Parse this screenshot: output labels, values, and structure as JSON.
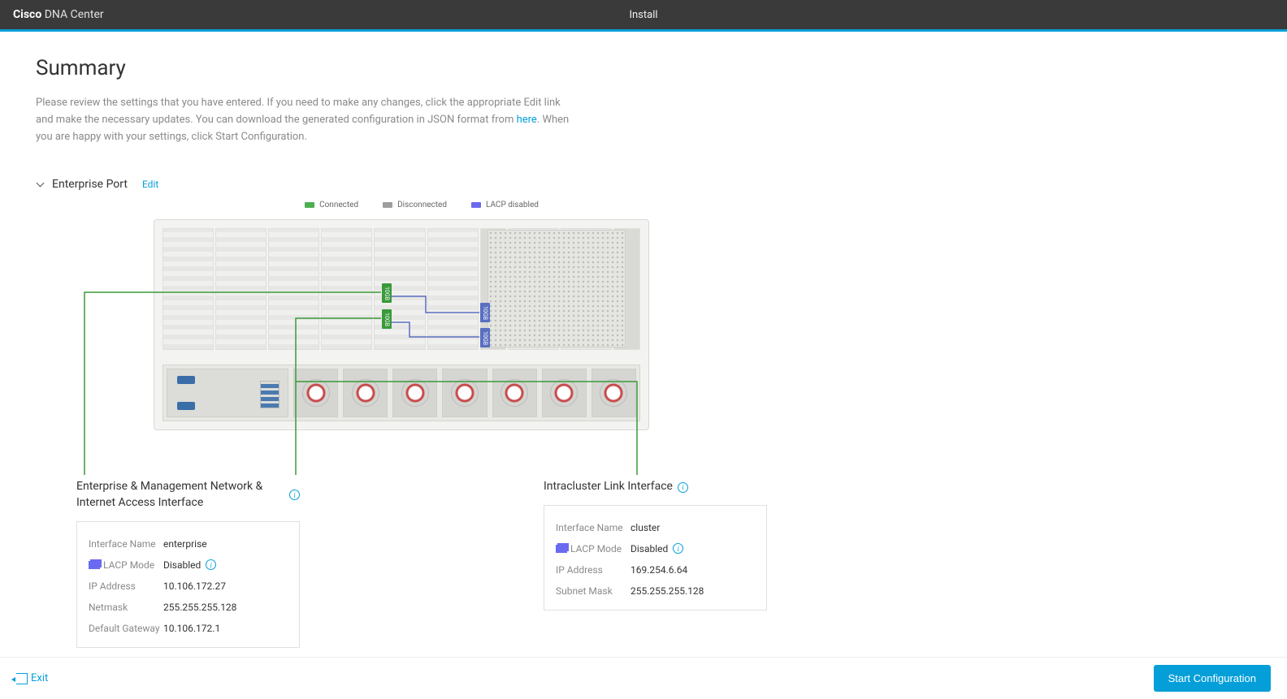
{
  "brand": {
    "bold": "Cisco",
    "light": " DNA Center"
  },
  "header": {
    "title": "Install"
  },
  "page": {
    "title": "Summary",
    "desc_pre": "Please review the settings that you have entered. If you need to make any changes, click the appropriate Edit link and make the necessary updates. You can download the generated configuration in JSON format from ",
    "here": "here",
    "desc_post": ". When you are happy with your settings, click Start Configuration."
  },
  "section": {
    "title": "Enterprise Port",
    "edit": "Edit"
  },
  "legend": {
    "connected": "Connected",
    "disconnected": "Disconnected",
    "lacp": "LACP disabled"
  },
  "ports": {
    "p1": "10GB",
    "p2": "10GB",
    "p3": "10GB",
    "p4": "10GB"
  },
  "callouts": {
    "enterprise": {
      "title": "Enterprise & Management Network & Internet Access Interface",
      "rows": {
        "iface_label": "Interface Name",
        "iface_value": "enterprise",
        "lacp_label": "LACP Mode",
        "lacp_value": "Disabled",
        "ip_label": "IP Address",
        "ip_value": "10.106.172.27",
        "netmask_label": "Netmask",
        "netmask_value": "255.255.255.128",
        "gw_label": "Default Gateway",
        "gw_value": "10.106.172.1"
      }
    },
    "intracluster": {
      "title": "Intracluster Link Interface",
      "rows": {
        "iface_label": "Interface Name",
        "iface_value": "cluster",
        "lacp_label": "LACP Mode",
        "lacp_value": "Disabled",
        "ip_label": "IP Address",
        "ip_value": "169.254.6.64",
        "subnet_label": "Subnet Mask",
        "subnet_value": "255.255.255.128"
      }
    }
  },
  "footer": {
    "exit": "Exit",
    "start": "Start Configuration"
  }
}
